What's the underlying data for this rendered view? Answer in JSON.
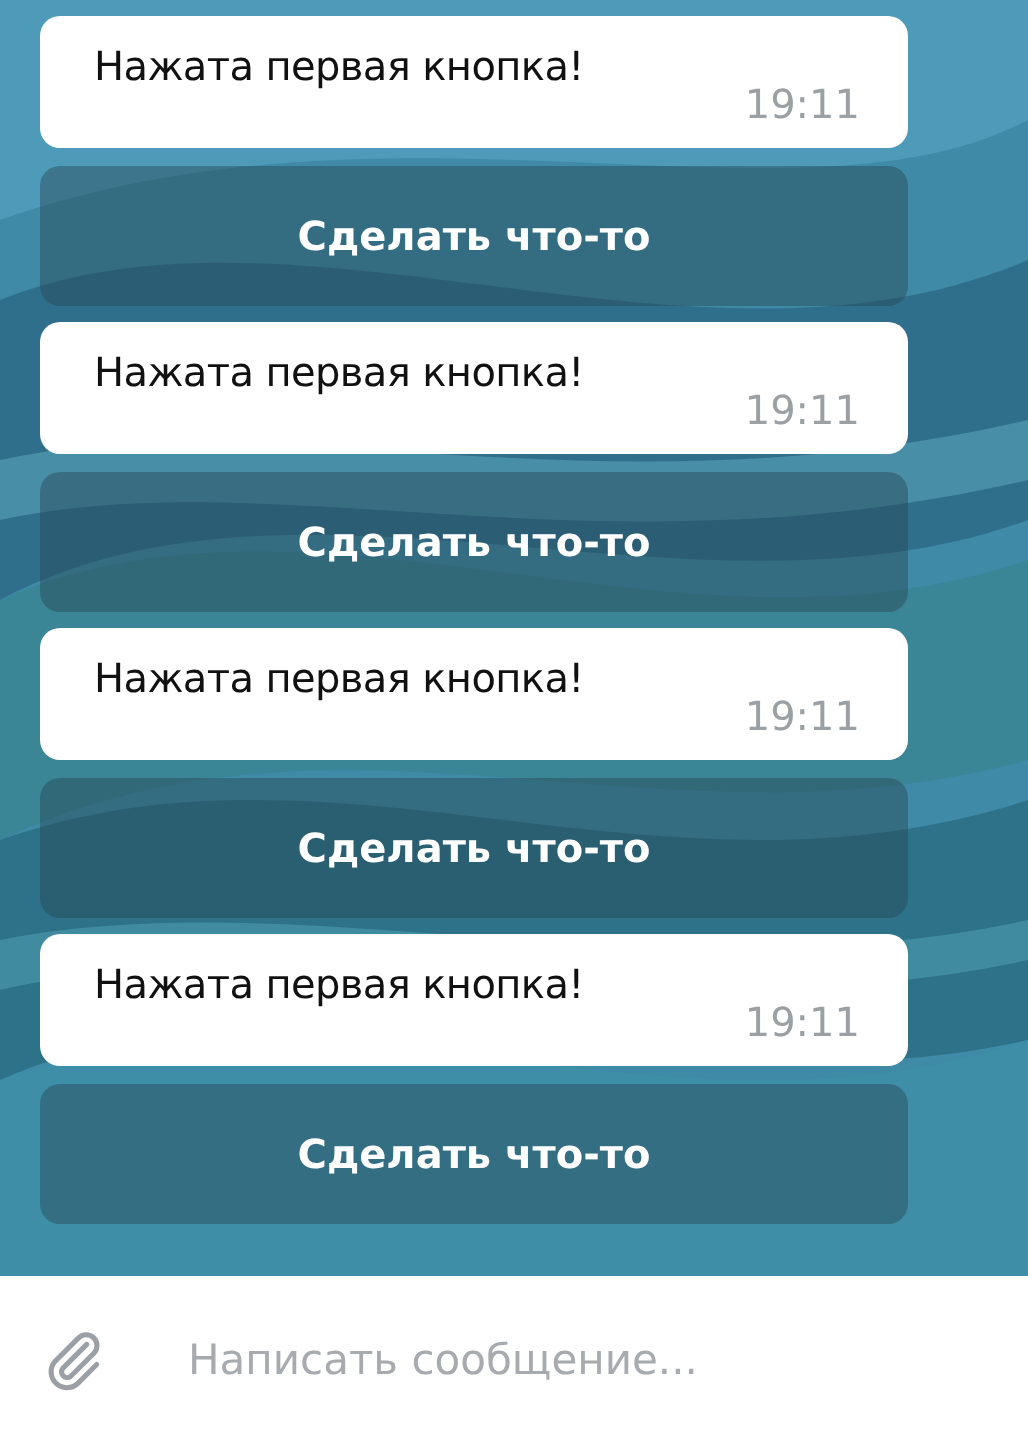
{
  "messages": [
    {
      "text": "Нажата первая кнопка!",
      "time": "19:11",
      "button": "Сделать что-то"
    },
    {
      "text": "Нажата первая кнопка!",
      "time": "19:11",
      "button": "Сделать что-то"
    },
    {
      "text": "Нажата первая кнопка!",
      "time": "19:11",
      "button": "Сделать что-то"
    },
    {
      "text": "Нажата первая кнопка!",
      "time": "19:11",
      "button": "Сделать что-то"
    }
  ],
  "composer": {
    "placeholder": "Написать сообщение..."
  }
}
